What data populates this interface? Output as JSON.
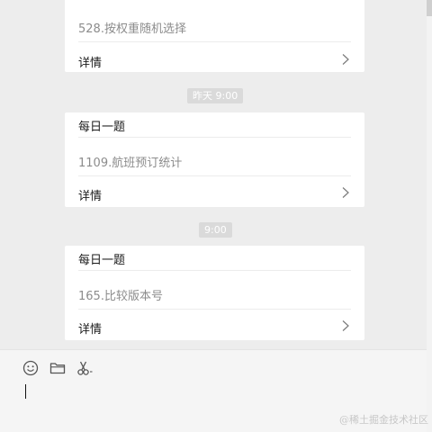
{
  "messages": [
    {
      "title": "",
      "problem": "528.按权重随机选择",
      "detail_label": "详情"
    },
    {
      "title": "每日一题",
      "problem": "1109.航班预订统计",
      "detail_label": "详情"
    },
    {
      "title": "每日一题",
      "problem": "165.比较版本号",
      "detail_label": "详情"
    }
  ],
  "timestamps": [
    "昨天 9:00",
    "9:00"
  ],
  "toolbar": {
    "icons": [
      "emoji-icon",
      "folder-icon",
      "scissors-icon"
    ]
  },
  "watermark": "@稀土掘金技术社区",
  "colors": {
    "chat_background": "#ededed",
    "card_background": "#ffffff",
    "timestamp_badge": "#dadada",
    "input_background": "#f5f5f5"
  }
}
